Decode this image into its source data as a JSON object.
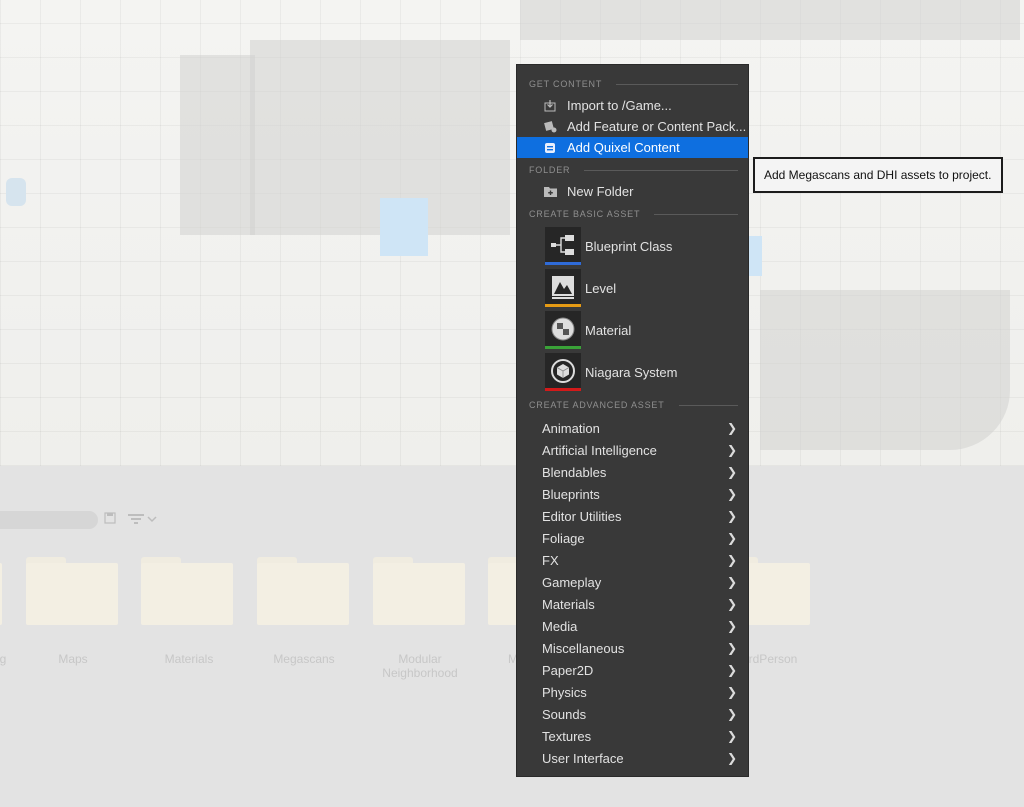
{
  "menu": {
    "sections": {
      "get_content": "GET CONTENT",
      "folder": "FOLDER",
      "create_basic_asset": "CREATE BASIC ASSET",
      "create_advanced_asset": "CREATE ADVANCED ASSET"
    },
    "get_content_items": [
      {
        "label": "Import to /Game...",
        "icon": "import-icon"
      },
      {
        "label": "Add Feature or Content Pack...",
        "icon": "content-pack-icon"
      },
      {
        "label": "Add Quixel Content",
        "icon": "quixel-icon",
        "highlighted": true
      }
    ],
    "folder_items": [
      {
        "label": "New Folder",
        "icon": "new-folder-icon"
      }
    ],
    "basic_assets": [
      {
        "label": "Blueprint Class",
        "icon": "blueprint-icon",
        "color": "#2f6bd8"
      },
      {
        "label": "Level",
        "icon": "level-icon",
        "color": "#e59a14"
      },
      {
        "label": "Material",
        "icon": "material-icon",
        "color": "#3aa238"
      },
      {
        "label": "Niagara System",
        "icon": "niagara-icon",
        "color": "#d31a1a"
      }
    ],
    "advanced_assets": [
      "Animation",
      "Artificial Intelligence",
      "Blendables",
      "Blueprints",
      "Editor Utilities",
      "Foliage",
      "FX",
      "Gameplay",
      "Materials",
      "Media",
      "Miscellaneous",
      "Paper2D",
      "Physics",
      "Sounds",
      "Textures",
      "User Interface"
    ],
    "highlight_color": "#0e6fe0"
  },
  "tooltip": {
    "text": "Add Megascans and DHI assets to project."
  },
  "browser": {
    "folders": [
      {
        "label": "g"
      },
      {
        "label": "Maps"
      },
      {
        "label": "Materials"
      },
      {
        "label": "Megascans"
      },
      {
        "label": "Modular\nNeighborhood"
      },
      {
        "label": "M"
      },
      {
        "label": "rdPerson"
      }
    ]
  }
}
